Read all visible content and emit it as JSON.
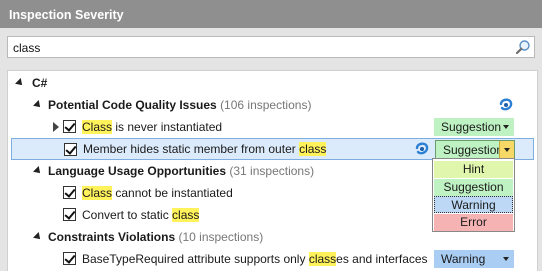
{
  "panel": {
    "title": "Inspection Severity"
  },
  "search": {
    "value": "class"
  },
  "tree": {
    "root": {
      "label": "C#"
    },
    "groups": [
      {
        "name": "Potential Code Quality Issues",
        "count": "(106 inspections)",
        "items": [
          {
            "before": "",
            "match": "Class",
            "after": " is never instantiated",
            "severity": "Suggestion",
            "expandable": true,
            "checked": true
          },
          {
            "before": "Member hides static member from outer ",
            "match": "class",
            "after": "",
            "severity": "Suggestion",
            "selected": true,
            "checked": true
          }
        ]
      },
      {
        "name": "Language Usage Opportunities",
        "count": "(31 inspections)",
        "items": [
          {
            "before": "",
            "match": "Class",
            "after": " cannot be instantiated",
            "checked": true
          },
          {
            "before": "Convert to static ",
            "match": "class",
            "after": "",
            "checked": true
          }
        ]
      },
      {
        "name": "Constraints Violations",
        "count": "(10 inspections)",
        "items": [
          {
            "before": "BaseTypeRequired attribute supports only ",
            "match": "class",
            "after": "es and interfaces",
            "severity": "Warning",
            "checked": true
          }
        ]
      }
    ]
  },
  "dropdown": {
    "options": [
      "Hint",
      "Suggestion",
      "Warning",
      "Error"
    ],
    "highlighted": "Warning"
  },
  "colors": {
    "header": "#8f8f8f",
    "suggestion": "#bff2c3",
    "warning": "#a9cdf3",
    "hint": "#dff6ac",
    "error": "#f5b3b3",
    "match_highlight": "#fff25a",
    "selection": "#dcebfb"
  },
  "icons": [
    "search-icon",
    "group-settings-icon",
    "item-settings-icon"
  ]
}
